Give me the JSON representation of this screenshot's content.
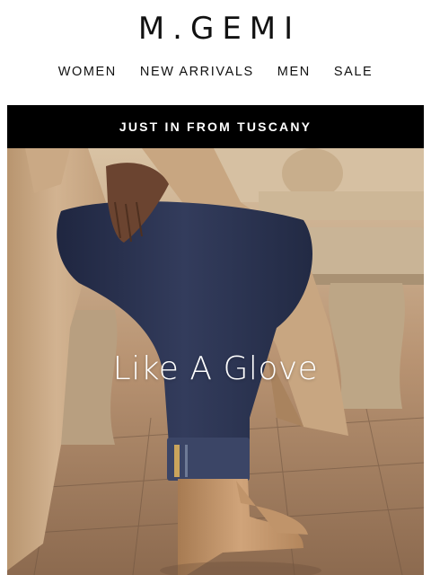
{
  "brand": {
    "logo_text": "M.GEMI"
  },
  "nav": {
    "items": [
      {
        "label": "WOMEN"
      },
      {
        "label": "NEW ARRIVALS"
      },
      {
        "label": "MEN"
      },
      {
        "label": "SALE"
      }
    ]
  },
  "banner": {
    "text": "JUST IN FROM TUSCANY"
  },
  "hero": {
    "headline": "Like A Glove",
    "colors": {
      "coat": "#c9a886",
      "denim": "#2b3350",
      "boot": "#c99c72",
      "stone": "#c2ad8e",
      "paving": "#9a7658"
    }
  }
}
